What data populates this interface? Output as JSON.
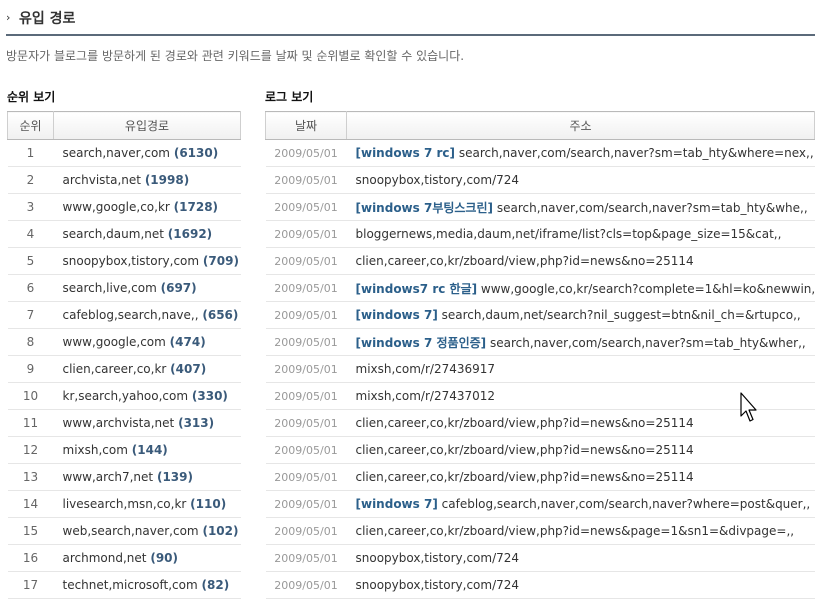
{
  "header": {
    "arrow": "›",
    "title": "유입 경로"
  },
  "description": "방문자가 블로그를 방문하게 된 경로와 관련 키워드를 날짜 및 순위별로 확인할 수 있습니다.",
  "rank_section": {
    "title": "순위 보기",
    "columns": [
      "순위",
      "유입경로"
    ],
    "rows": [
      {
        "rank": "1",
        "source": "search,naver,com",
        "count": "(6130)"
      },
      {
        "rank": "2",
        "source": "archvista,net",
        "count": "(1998)"
      },
      {
        "rank": "3",
        "source": "www,google,co,kr",
        "count": "(1728)"
      },
      {
        "rank": "4",
        "source": "search,daum,net",
        "count": "(1692)"
      },
      {
        "rank": "5",
        "source": "snoopybox,tistory,com",
        "count": "(709)"
      },
      {
        "rank": "6",
        "source": "search,live,com",
        "count": "(697)"
      },
      {
        "rank": "7",
        "source": "cafeblog,search,nave,,",
        "count": "(656)"
      },
      {
        "rank": "8",
        "source": "www,google,com",
        "count": "(474)"
      },
      {
        "rank": "9",
        "source": "clien,career,co,kr",
        "count": "(407)"
      },
      {
        "rank": "10",
        "source": "kr,search,yahoo,com",
        "count": "(330)"
      },
      {
        "rank": "11",
        "source": "www,archvista,net",
        "count": "(313)"
      },
      {
        "rank": "12",
        "source": "mixsh,com",
        "count": "(144)"
      },
      {
        "rank": "13",
        "source": "www,arch7,net",
        "count": "(139)"
      },
      {
        "rank": "14",
        "source": "livesearch,msn,co,kr",
        "count": "(110)"
      },
      {
        "rank": "15",
        "source": "web,search,naver,com",
        "count": "(102)"
      },
      {
        "rank": "16",
        "source": "archmond,net",
        "count": "(90)"
      },
      {
        "rank": "17",
        "source": "technet,microsoft,com",
        "count": "(82)"
      }
    ]
  },
  "log_section": {
    "title": "로그 보기",
    "columns": [
      "날짜",
      "주소"
    ],
    "rows": [
      {
        "date": "2009/05/01",
        "keyword": "[windows 7 rc]",
        "url": "search,naver,com/search,naver?sm=tab_hty&where=nex,,"
      },
      {
        "date": "2009/05/01",
        "keyword": "",
        "url": "snoopybox,tistory,com/724"
      },
      {
        "date": "2009/05/01",
        "keyword": "[windows 7부팅스크린]",
        "url": "search,naver,com/search,naver?sm=tab_hty&whe,,"
      },
      {
        "date": "2009/05/01",
        "keyword": "",
        "url": "bloggernews,media,daum,net/iframe/list?cls=top&page_size=15&cat,,"
      },
      {
        "date": "2009/05/01",
        "keyword": "",
        "url": "clien,career,co,kr/zboard/view,php?id=news&no=25114"
      },
      {
        "date": "2009/05/01",
        "keyword": "[windows7 rc 한글]",
        "url": "www,google,co,kr/search?complete=1&hl=ko&newwin,,"
      },
      {
        "date": "2009/05/01",
        "keyword": "[windows 7]",
        "url": "search,daum,net/search?nil_suggest=btn&nil_ch=&rtupco,,"
      },
      {
        "date": "2009/05/01",
        "keyword": "[windows 7 정품인증]",
        "url": "search,naver,com/search,naver?sm=tab_hty&wher,,"
      },
      {
        "date": "2009/05/01",
        "keyword": "",
        "url": "mixsh,com/r/27436917"
      },
      {
        "date": "2009/05/01",
        "keyword": "",
        "url": "mixsh,com/r/27437012"
      },
      {
        "date": "2009/05/01",
        "keyword": "",
        "url": "clien,career,co,kr/zboard/view,php?id=news&no=25114"
      },
      {
        "date": "2009/05/01",
        "keyword": "",
        "url": "clien,career,co,kr/zboard/view,php?id=news&no=25114"
      },
      {
        "date": "2009/05/01",
        "keyword": "",
        "url": "clien,career,co,kr/zboard/view,php?id=news&no=25114"
      },
      {
        "date": "2009/05/01",
        "keyword": "[windows 7]",
        "url": "cafeblog,search,naver,com/search,naver?where=post&quer,,"
      },
      {
        "date": "2009/05/01",
        "keyword": "",
        "url": "clien,career,co,kr/zboard/view,php?id=news&page=1&sn1=&divpage=,,"
      },
      {
        "date": "2009/05/01",
        "keyword": "",
        "url": "snoopybox,tistory,com/724"
      },
      {
        "date": "2009/05/01",
        "keyword": "",
        "url": "snoopybox,tistory,com/724"
      }
    ]
  },
  "colors": {
    "count": "#3a5a7a",
    "keyword": "#2b5f8a",
    "header_rule": "#5b6a7a"
  }
}
